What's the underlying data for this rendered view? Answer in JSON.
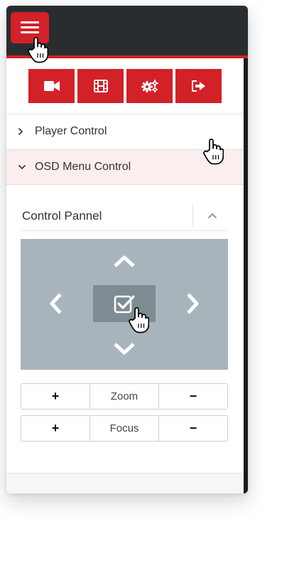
{
  "theme": {
    "accent": "#d32128",
    "header_bg": "#2a2d30",
    "pad_bg": "#a8b4bc",
    "pad_button_bg": "#7f8c93"
  },
  "header": {
    "menu_icon": "hamburger-icon"
  },
  "toolbar": {
    "buttons": [
      {
        "icon": "video-camera-icon"
      },
      {
        "icon": "film-icon"
      },
      {
        "icon": "gears-icon"
      },
      {
        "icon": "sign-out-icon"
      }
    ]
  },
  "accordion": {
    "items": [
      {
        "label": "Player Control",
        "expanded": false
      },
      {
        "label": "OSD Menu Control",
        "expanded": true
      }
    ]
  },
  "control_panel": {
    "title": "Control Pannel",
    "collapse_icon": "chevron-up-icon",
    "dpad": {
      "up": "chevron-up-icon",
      "down": "chevron-down-icon",
      "left": "chevron-left-icon",
      "right": "chevron-right-icon",
      "ok": "check-square-icon"
    },
    "rows": [
      {
        "plus": "+",
        "label": "Zoom",
        "minus": "−"
      },
      {
        "plus": "+",
        "label": "Focus",
        "minus": "−"
      }
    ]
  }
}
